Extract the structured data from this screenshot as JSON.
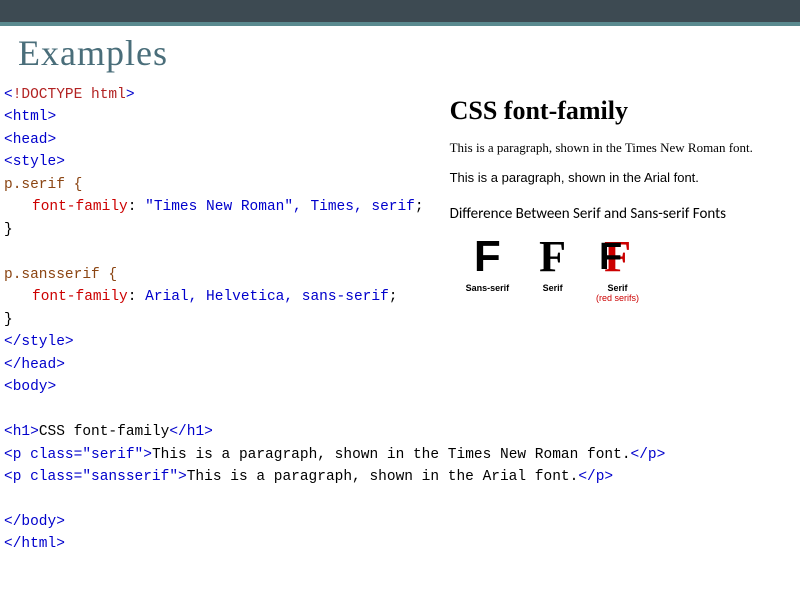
{
  "slide": {
    "title": "Examples"
  },
  "code": {
    "doctype": "<!DOCTYPE html>",
    "html_open": "<html>",
    "head_open": "<head>",
    "style_open": "<style>",
    "selector1": "p.serif {",
    "prop1_name": "font-family",
    "prop1_value": "\"Times New Roman\", Times, serif",
    "close1": "}",
    "selector2": "p.sansserif {",
    "prop2_name": "font-family",
    "prop2_value": "Arial, Helvetica, sans-serif",
    "close2": "}",
    "style_close": "</style>",
    "head_close": "</head>",
    "body_open": "<body>",
    "h1_open": "<h1>",
    "h1_text": "CSS font-family",
    "h1_close": "</h1>",
    "p1_open": "<p class=\"serif\">",
    "p1_text": "This is a paragraph, shown in the Times New Roman font.",
    "p1_close": "</p>",
    "p2_open": "<p class=\"sansserif\">",
    "p2_text": "This is a paragraph, shown in the Arial font.",
    "p2_close": "</p>",
    "body_close": "</body>",
    "html_close": "</html>"
  },
  "rendered": {
    "heading": "CSS font-family",
    "paragraph_serif": "This is a paragraph, shown in the Times New Roman font.",
    "paragraph_sans": "This is a paragraph, shown in the Arial font.",
    "difference_title": "Difference Between Serif and Sans-serif Fonts",
    "letters": {
      "sans_letter": "F",
      "serif_letter": "F",
      "serif_red_letter": "F",
      "sans_label": "Sans-serif",
      "serif_label": "Serif",
      "serif_red_label1": "Serif",
      "serif_red_label2": "(red serifs)"
    }
  }
}
